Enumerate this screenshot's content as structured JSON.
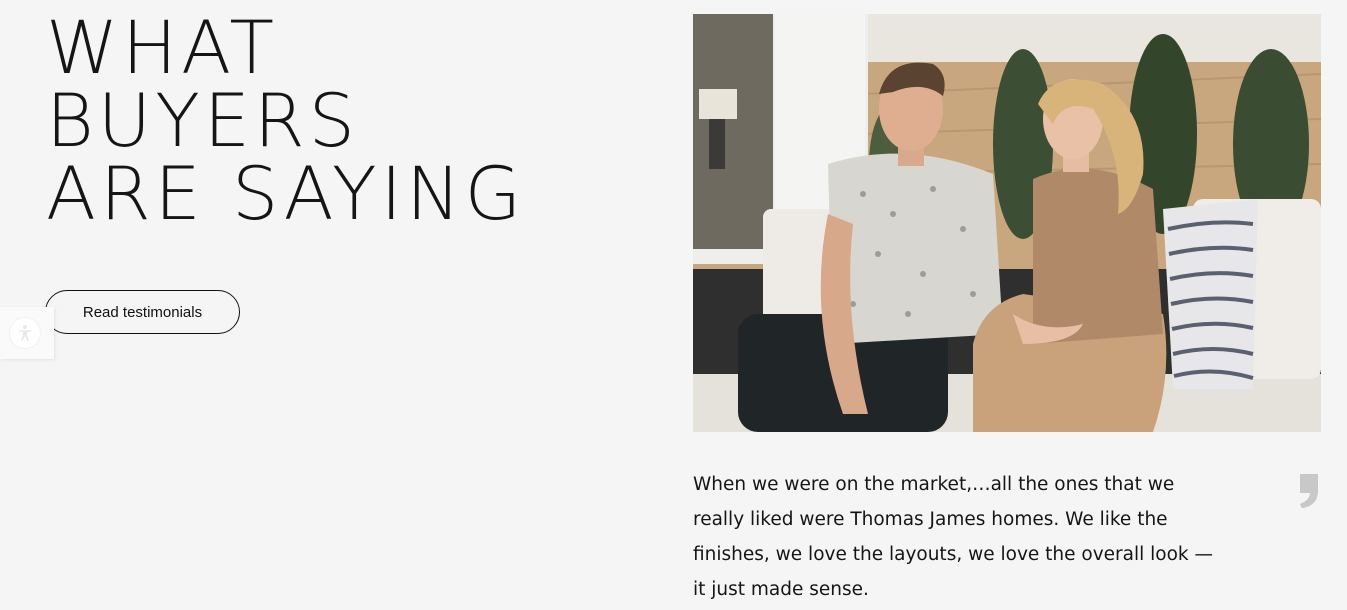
{
  "section": {
    "headline_lines": [
      "WHAT",
      "BUYERS",
      "ARE SAYING"
    ],
    "cta_label": "Read testimonials"
  },
  "accessibility": {
    "icon": "accessibility-icon"
  },
  "photo": {
    "description_icon": "couple-photo"
  },
  "testimonial": {
    "quote_icon": "quote-mark-icon",
    "text": "When we were on the market,…all the ones that we really liked were Thomas James homes. We like the finishes, we love the layouts, we love the overall look —it just made sense."
  },
  "colors": {
    "background": "#f5f5f5",
    "text": "#111111",
    "quote_mark": "#c8c8c8"
  }
}
